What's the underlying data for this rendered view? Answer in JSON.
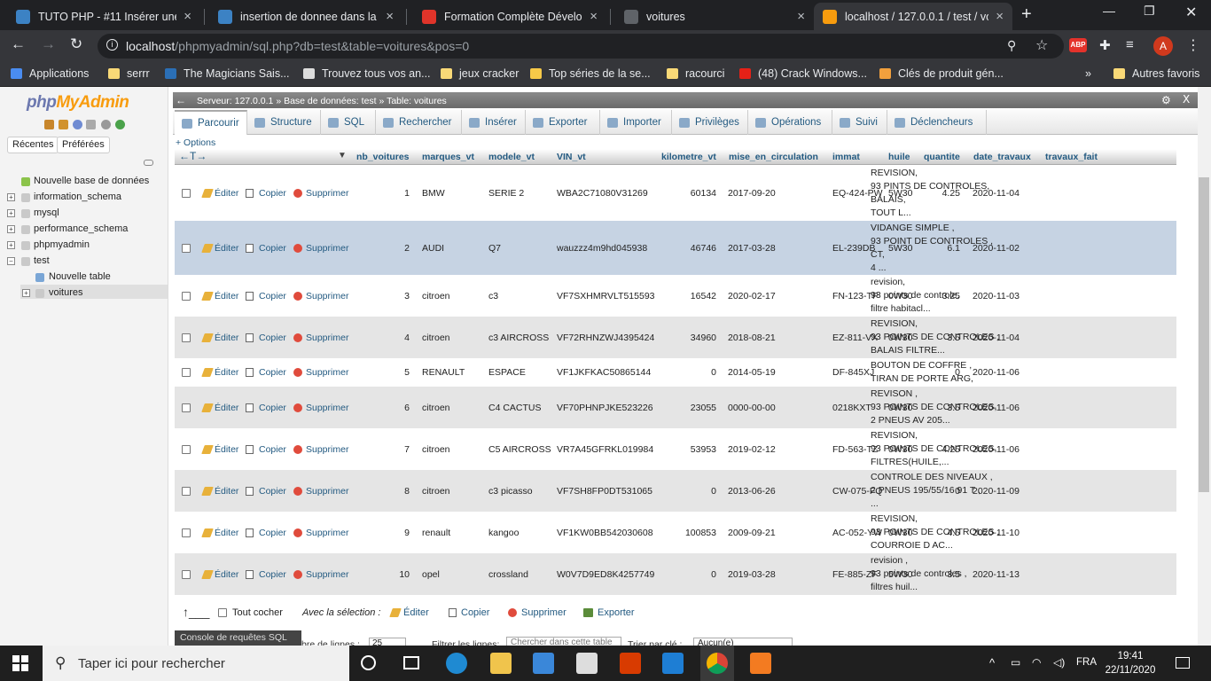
{
  "browser": {
    "tabs": [
      {
        "title": "TUTO PHP - #11 Insérer une en",
        "close": "×",
        "fav": "#3c82c4"
      },
      {
        "title": "insertion de donnee dans la ba",
        "close": "×",
        "fav": "#3c82c4"
      },
      {
        "title": "Formation Complète Développ",
        "close": "×",
        "fav": "#e0342a"
      },
      {
        "title": "voitures",
        "close": "×",
        "fav": "#5f6368"
      },
      {
        "title": "localhost / 127.0.0.1 / test / vo",
        "close": "×",
        "fav": "#f89c0e"
      }
    ],
    "new_tab": "+",
    "url": "localhost/phpmyadmin/sql.php?db=test&table=voitures&pos=0",
    "url_host": "localhost",
    "url_rest": "/phpmyadmin/sql.php?db=test&table=voitures&pos=0",
    "profile": "A",
    "abp": "ABP",
    "bookmarks": [
      "Applications",
      "serrr",
      "The Magicians Sais...",
      "Trouvez tous vos an...",
      "jeux cracker",
      "Top séries de la se...",
      "racourci",
      "(48) Crack Windows...",
      "Clés de produit gén..."
    ],
    "bookmarks_more": "»",
    "other_bookmarks": "Autres favoris"
  },
  "pma": {
    "logo_a": "php",
    "logo_b": "MyAdmin",
    "recent": "Récentes",
    "favorites": "Préférées",
    "tree": [
      "Nouvelle base de données",
      "information_schema",
      "mysql",
      "performance_schema",
      "phpmyadmin",
      "test",
      "Nouvelle table",
      "voitures"
    ],
    "breadcrumb": {
      "server": "Serveur: 127.0.0.1",
      "sep": "»",
      "db": "Base de données: test",
      "table": "Table: voitures"
    },
    "tabs": [
      "Parcourir",
      "Structure",
      "SQL",
      "Rechercher",
      "Insérer",
      "Exporter",
      "Importer",
      "Privilèges",
      "Opérations",
      "Suivi",
      "Déclencheurs"
    ],
    "options": "+ Options",
    "columns": [
      "nb_voitures",
      "marques_vt",
      "modele_vt",
      "VIN_vt",
      "kilometre_vt",
      "mise_en_circulation",
      "immat",
      "huile",
      "quantite",
      "date_travaux",
      "travaux_fait"
    ],
    "row_actions": {
      "edit": "Éditer",
      "copy": "Copier",
      "delete": "Supprimer"
    },
    "rows": [
      {
        "nb": "1",
        "marque": "BMW",
        "modele": "SERIE 2",
        "vin": "WBA2C71080V31269",
        "km": "60134",
        "mise": "2017-09-20",
        "immat": "EQ-424-PW",
        "huile": "5W30",
        "qte": "4.25",
        "date": "2020-11-04",
        "travaux": [
          "REVISION,",
          "93 PINTS DE CONTROLES,",
          "BALAIS,",
          "TOUT L..."
        ]
      },
      {
        "nb": "2",
        "marque": "AUDI",
        "modele": "Q7",
        "vin": "wauzzz4m9hd045938",
        "km": "46746",
        "mise": "2017-03-28",
        "immat": "EL-239DB",
        "huile": "5W30",
        "qte": "6.1",
        "date": "2020-11-02",
        "travaux": [
          "VIDANGE SIMPLE ,",
          "93 POINT DE CONTROLES ,",
          "CT,",
          "4 ..."
        ]
      },
      {
        "nb": "3",
        "marque": "citroen",
        "modele": "c3",
        "vin": "VF7SXHMRVLT515593",
        "km": "16542",
        "mise": "2020-02-17",
        "immat": "FN-123-TP",
        "huile": "0W30",
        "qte": "3.25",
        "date": "2020-11-03",
        "travaux": [
          "revision,",
          "93 points de controle,",
          "filtre habitacl..."
        ]
      },
      {
        "nb": "4",
        "marque": "citroen",
        "modele": "c3 AIRCROSS",
        "vin": "VF72RHNZWJ4395424",
        "km": "34960",
        "mise": "2018-08-21",
        "immat": "EZ-811-VX",
        "huile": "0W30",
        "qte": "3.5",
        "date": "2020-11-04",
        "travaux": [
          "REVISION,",
          "93 POINTS DE CONTROLES ,",
          "BALAIS FILTRE..."
        ]
      },
      {
        "nb": "5",
        "marque": "RENAULT",
        "modele": "ESPACE",
        "vin": "VF1JKFKAC50865144",
        "km": "0",
        "mise": "2014-05-19",
        "immat": "DF-845XJ",
        "huile": "",
        "qte": "0",
        "date": "2020-11-06",
        "travaux": [
          "BOUTON DE COFFRE ,",
          "TIRAN DE PORTE ARG,"
        ]
      },
      {
        "nb": "6",
        "marque": "citroen",
        "modele": "C4 CACTUS",
        "vin": "VF70PHNPJKE523226",
        "km": "23055",
        "mise": "0000-00-00",
        "immat": "0218KXT",
        "huile": "0W30",
        "qte": "3.5",
        "date": "2020-11-06",
        "travaux": [
          "REVISON ,",
          "93 POINTS DE CONTROLES,",
          "2 PNEUS AV 205..."
        ]
      },
      {
        "nb": "7",
        "marque": "citroen",
        "modele": "C5 AIRCROSS",
        "vin": "VR7A45GFRKL019984",
        "km": "53953",
        "mise": "2019-02-12",
        "immat": "FD-563-TZ",
        "huile": "0W30",
        "qte": "4.25",
        "date": "2020-11-06",
        "travaux": [
          "REVISION,",
          "93 POINTS DE CONTROLES,",
          "FILTRES(HUILE,..."
        ]
      },
      {
        "nb": "8",
        "marque": "citroen",
        "modele": "c3 picasso",
        "vin": "VF7SH8FP0DT531065",
        "km": "0",
        "mise": "2013-06-26",
        "immat": "CW-075-FQ",
        "huile": "",
        "qte": "0",
        "date": "2020-11-09",
        "travaux": [
          "CONTROLE DES NIVEAUX ,",
          "2 PNEUS 195/55/16 91 T ,",
          "..."
        ]
      },
      {
        "nb": "9",
        "marque": "renault",
        "modele": "kangoo",
        "vin": "VF1KW0BB542030608",
        "km": "100853",
        "mise": "2009-09-21",
        "immat": "AC-052-YW",
        "huile": "0W30",
        "qte": "4.5",
        "date": "2020-11-10",
        "travaux": [
          "REVISION,",
          "93 POINTS DE CONTROLES ,",
          "COURROIE D AC..."
        ]
      },
      {
        "nb": "10",
        "marque": "opel",
        "modele": "crossland",
        "vin": "W0V7D9ED8K4257749",
        "km": "0",
        "mise": "2019-03-28",
        "immat": "FE-885-ZF",
        "huile": "5W30",
        "qte": "3.5",
        "date": "2020-11-13",
        "travaux": [
          "revision ,",
          "93 points de controles ,",
          "filtres huil..."
        ]
      }
    ],
    "bottom": {
      "check_all": "Tout cocher",
      "with_selection": "Avec la sélection :",
      "edit": "Éditer",
      "copy": "Copier",
      "delete": "Supprimer",
      "export": "Exporter"
    },
    "console": "Console de requêtes SQL",
    "partial": {
      "rows_label": "bre de lignes :",
      "rows_value": "25",
      "filter_label": "Filtrer les lignes:",
      "filter_placeholder": "Chercher dans cette table",
      "sort_label": "Trier par clé :",
      "sort_value": "Aucun(e)"
    }
  },
  "taskbar": {
    "search": "Taper ici pour rechercher",
    "lang": "FRA",
    "time": "19:41",
    "date": "22/11/2020"
  }
}
